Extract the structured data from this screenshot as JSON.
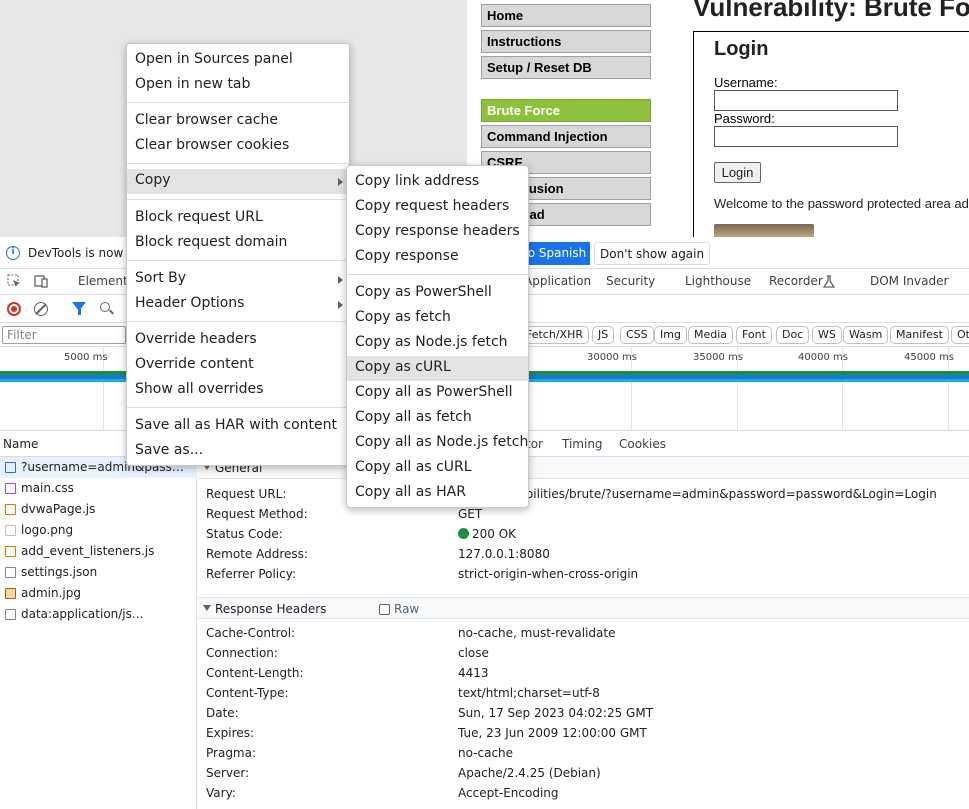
{
  "dvwa": {
    "title": "Vulnerability: Brute Fo",
    "menu": [
      "Home",
      "Instructions",
      "Setup / Reset DB",
      "Brute Force",
      "Command Injection",
      "CSRF",
      "clusion",
      "load"
    ],
    "login_heading": "Login",
    "username_label": "Username:",
    "password_label": "Password:",
    "login_button": "Login",
    "welcome_text": "Welcome to the password protected area ad"
  },
  "devtools": {
    "infobar": {
      "text": "DevTools is now av",
      "switch_button": "to Spanish",
      "dismiss_button": "Don't show again"
    },
    "tabs": [
      "Elements",
      "Application",
      "Security",
      "Lighthouse",
      "Recorder",
      "DOM Invader"
    ],
    "filter_placeholder": "Filter",
    "type_chips": [
      "Fetch/XHR",
      "JS",
      "CSS",
      "Img",
      "Media",
      "Font",
      "Doc",
      "WS",
      "Wasm",
      "Manifest",
      "Ot"
    ],
    "timeline_ticks": [
      "5000 ms",
      "30000 ms",
      "35000 ms",
      "40000 ms",
      "45000 ms"
    ],
    "list_header": "Name",
    "requests": [
      {
        "name": "?username=admin&password...",
        "icon": "document-icon",
        "color": "#1a73e8"
      },
      {
        "name": "main.css",
        "icon": "stylesheet-icon",
        "color": "#a142f4"
      },
      {
        "name": "dvwaPage.js",
        "icon": "script-icon",
        "color": "#e37400"
      },
      {
        "name": "logo.png",
        "icon": "image-icon",
        "color": "#80868b"
      },
      {
        "name": "add_event_listeners.js",
        "icon": "script-icon",
        "color": "#e37400"
      },
      {
        "name": "settings.json",
        "icon": "file-icon",
        "color": "#5f6368"
      },
      {
        "name": "admin.jpg",
        "icon": "image-icon",
        "color": "#b06000"
      },
      {
        "name": "data:application/js...",
        "icon": "file-icon",
        "color": "#5f6368"
      }
    ],
    "detail_tabs": [
      "tor",
      "Timing",
      "Cookies"
    ],
    "general": {
      "heading": "General",
      "rows": [
        {
          "key": "Request URL:",
          "value": "ost/vulnerabilities/brute/?username=admin&password=password&Login=Login"
        },
        {
          "key": "Request Method:",
          "value": "GET"
        },
        {
          "key": "Status Code:",
          "value": "200 OK"
        },
        {
          "key": "Remote Address:",
          "value": "127.0.0.1:8080"
        },
        {
          "key": "Referrer Policy:",
          "value": "strict-origin-when-cross-origin"
        }
      ]
    },
    "response_headers": {
      "heading": "Response Headers",
      "raw_label": "Raw",
      "rows": [
        {
          "key": "Cache-Control:",
          "value": "no-cache, must-revalidate"
        },
        {
          "key": "Connection:",
          "value": "close"
        },
        {
          "key": "Content-Length:",
          "value": "4413"
        },
        {
          "key": "Content-Type:",
          "value": "text/html;charset=utf-8"
        },
        {
          "key": "Date:",
          "value": "Sun, 17 Sep 2023 04:02:25 GMT"
        },
        {
          "key": "Expires:",
          "value": "Tue, 23 Jun 2009 12:00:00 GMT"
        },
        {
          "key": "Pragma:",
          "value": "no-cache"
        },
        {
          "key": "Server:",
          "value": "Apache/2.4.25 (Debian)"
        },
        {
          "key": "Vary:",
          "value": "Accept-Encoding"
        }
      ]
    }
  },
  "context_menu": {
    "items": [
      "Open in Sources panel",
      "Open in new tab",
      "Clear browser cache",
      "Clear browser cookies",
      "Copy",
      "Block request URL",
      "Block request domain",
      "Sort By",
      "Header Options",
      "Override headers",
      "Override content",
      "Show all overrides",
      "Save all as HAR with content",
      "Save as..."
    ]
  },
  "copy_submenu": {
    "items": [
      "Copy link address",
      "Copy request headers",
      "Copy response headers",
      "Copy response",
      "Copy as PowerShell",
      "Copy as fetch",
      "Copy as Node.js fetch",
      "Copy as cURL",
      "Copy all as PowerShell",
      "Copy all as fetch",
      "Copy all as Node.js fetch",
      "Copy all as cURL",
      "Copy all as HAR"
    ]
  }
}
